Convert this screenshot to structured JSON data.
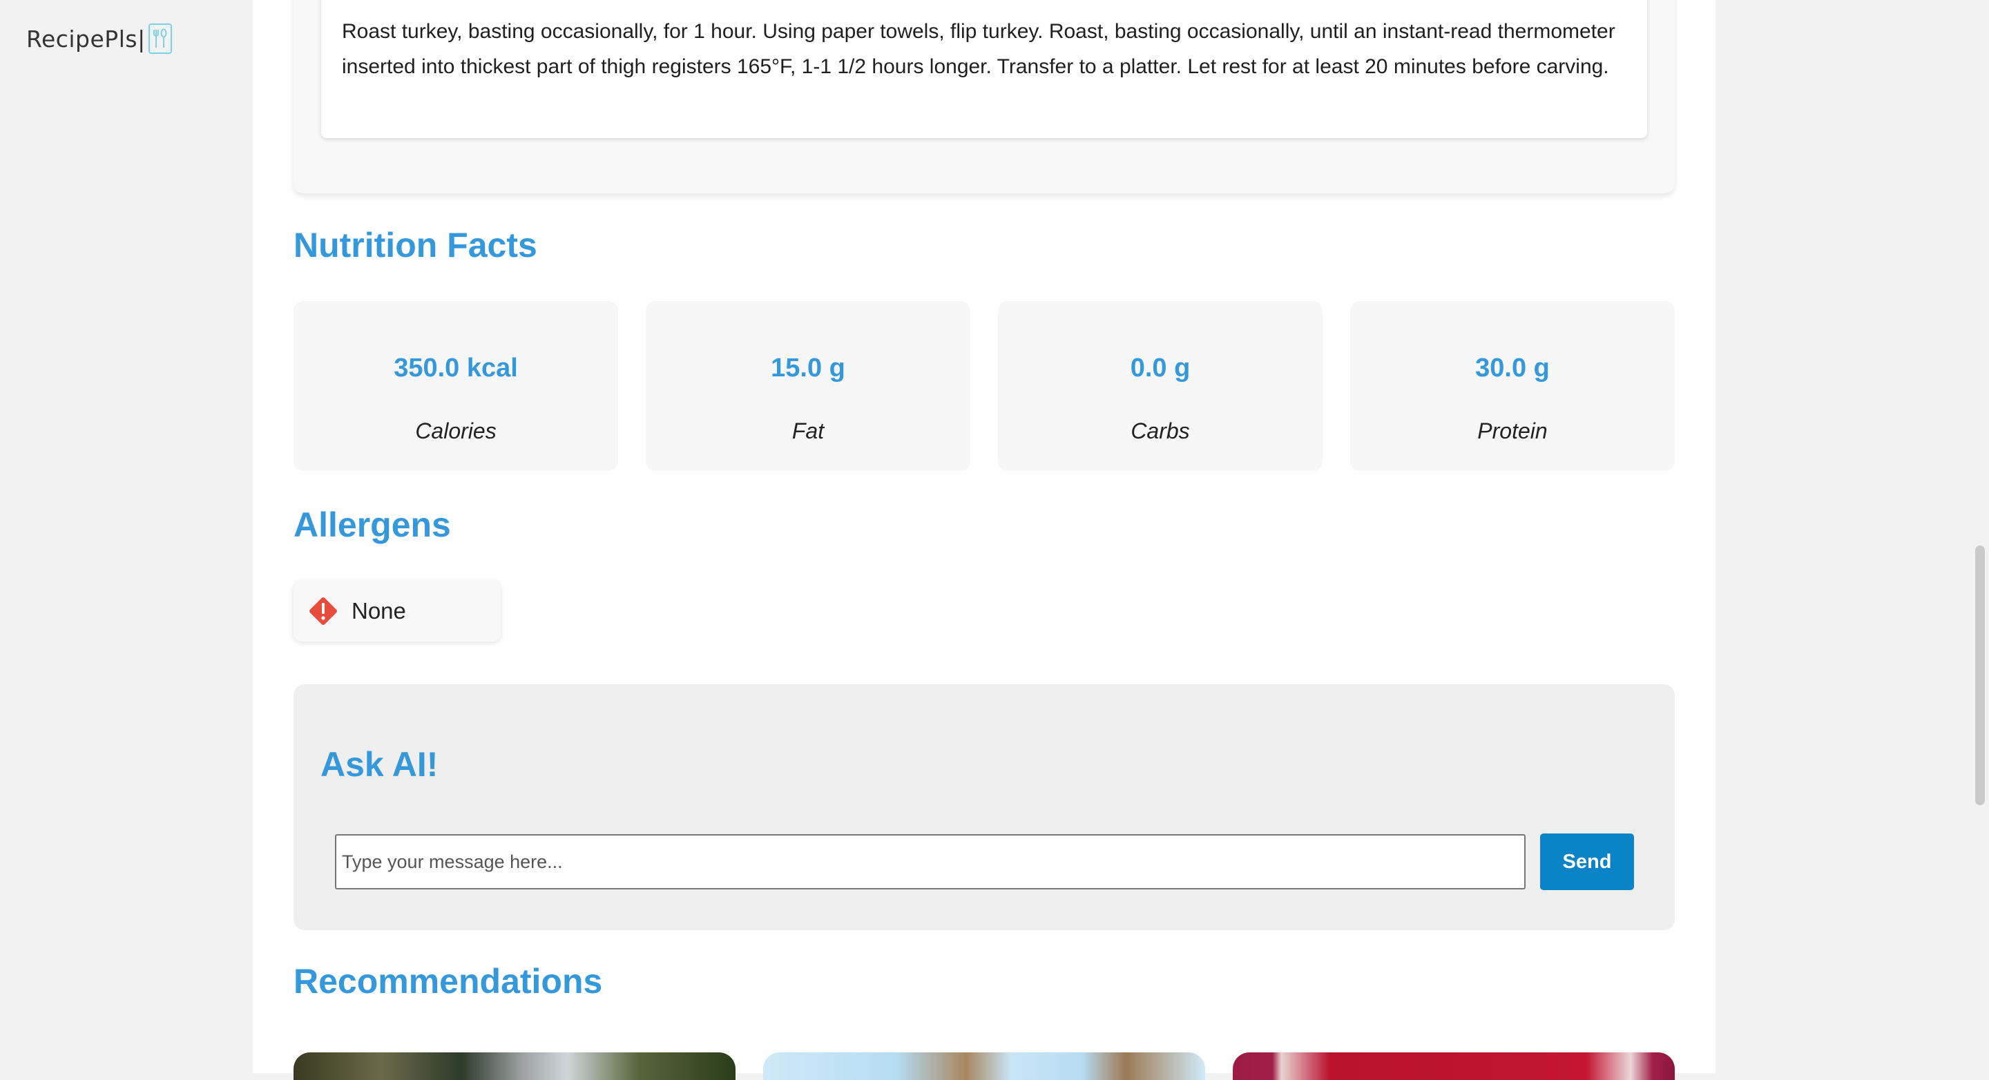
{
  "app": {
    "logo_text": "RecipePls|",
    "logo_icon": "utensils-icon"
  },
  "instructions": {
    "step_text": "Roast turkey, basting occasionally, for 1 hour. Using paper towels, flip turkey. Roast, basting occasionally, until an instant-read thermometer inserted into thickest part of thigh registers 165°F, 1-1 1/2 hours longer. Transfer to a platter. Let rest for at least 20 minutes before carving."
  },
  "nutrition": {
    "title": "Nutrition Facts",
    "items": [
      {
        "value": "350.0 kcal",
        "label": "Calories"
      },
      {
        "value": "15.0 g",
        "label": "Fat"
      },
      {
        "value": "0.0 g",
        "label": "Carbs"
      },
      {
        "value": "30.0 g",
        "label": "Protein"
      }
    ]
  },
  "allergens": {
    "title": "Allergens",
    "items": [
      {
        "label": "None",
        "icon": "warning-diamond-icon"
      }
    ]
  },
  "ask_ai": {
    "title": "Ask AI!",
    "input_placeholder": "Type your message here...",
    "input_value": "",
    "send_label": "Send"
  },
  "recommendations": {
    "title": "Recommendations"
  },
  "colors": {
    "accent": "#3498db",
    "send_button": "#0a84c6",
    "warning": "#e74c3c"
  }
}
